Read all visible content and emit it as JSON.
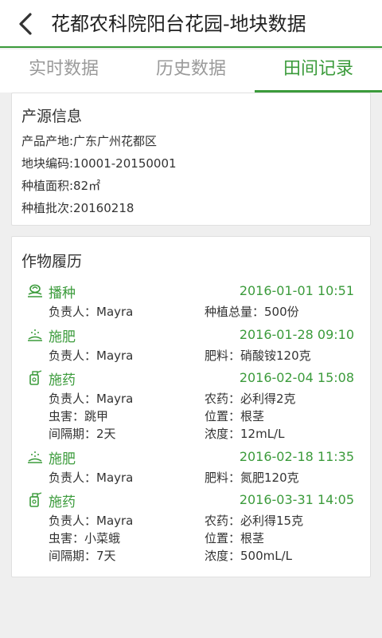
{
  "header": {
    "title": "花都农科院阳台花园-地块数据",
    "back_icon": "chevron-left-icon"
  },
  "tabs": [
    {
      "label": "实时数据",
      "active": false
    },
    {
      "label": "历史数据",
      "active": false
    },
    {
      "label": "田间记录",
      "active": true
    }
  ],
  "origin": {
    "title": "产源信息",
    "lines": [
      "产品产地:广东广州花都区",
      "地块编码:10001-20150001",
      "种植面积:82㎡",
      "种植批次:20160218"
    ]
  },
  "history": {
    "title": "作物履历",
    "records": [
      {
        "icon": "seed-icon",
        "name": "播种",
        "time": "2016-01-01 10:51",
        "rows": [
          [
            "负责人：Mayra",
            "种植总量：500份"
          ]
        ]
      },
      {
        "icon": "fertilizer-icon",
        "name": "施肥",
        "time": "2016-01-28 09:10",
        "rows": [
          [
            "负责人：Mayra",
            "肥料：硝酸铵120克"
          ]
        ]
      },
      {
        "icon": "spray-icon",
        "name": "施药",
        "time": "2016-02-04 15:08",
        "rows": [
          [
            "负责人：Mayra",
            "农药：必利得2克"
          ],
          [
            "虫害：跳甲",
            "位置：根茎"
          ],
          [
            "间隔期：2天",
            "浓度：12mL/L"
          ]
        ]
      },
      {
        "icon": "fertilizer-icon",
        "name": "施肥",
        "time": "2016-02-18 11:35",
        "rows": [
          [
            "负责人：Mayra",
            "肥料：氮肥120克"
          ]
        ]
      },
      {
        "icon": "spray-icon",
        "name": "施药",
        "time": "2016-03-31 14:05",
        "rows": [
          [
            "负责人：Mayra",
            "农药：必利得15克"
          ],
          [
            "虫害：小菜蛾",
            "位置：根茎"
          ],
          [
            "间隔期：7天",
            "浓度：500mL/L"
          ]
        ]
      }
    ]
  },
  "colors": {
    "accent": "#3b9b3b",
    "background": "#efefef",
    "text": "#333333",
    "tab_inactive": "#9a9a9a"
  }
}
